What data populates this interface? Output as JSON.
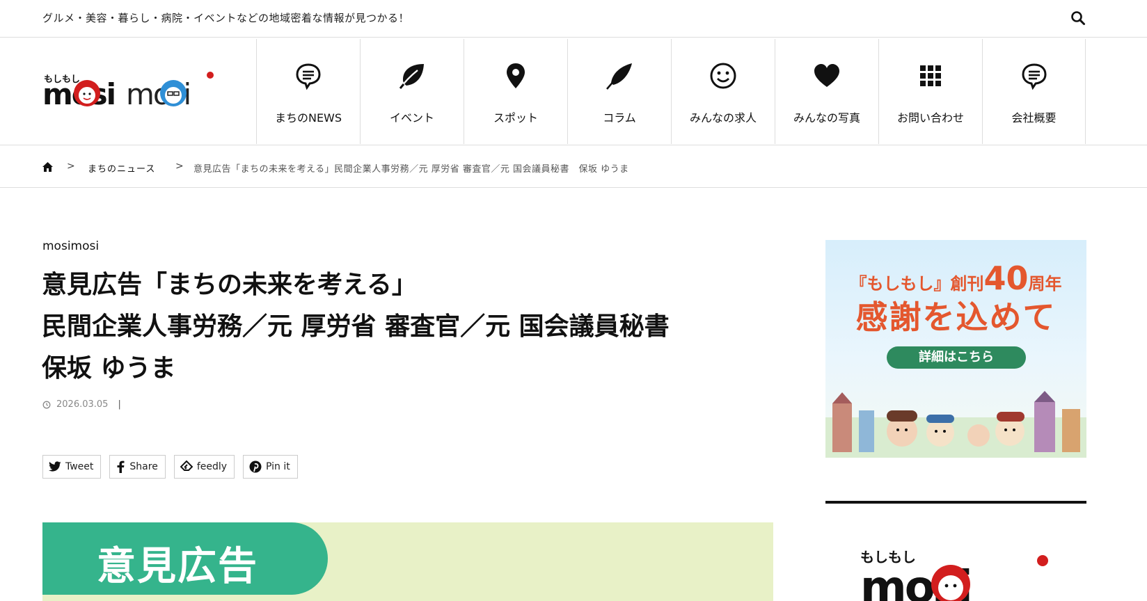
{
  "topbar": {
    "tagline": "グルメ・美容・暮らし・病院・イベントなどの地域密着な情報が見つかる！",
    "search_icon": "search-icon"
  },
  "logo": {
    "kana": "もしもし",
    "text_left": "mosi",
    "text_right": "mosi"
  },
  "nav": [
    {
      "label": "まちのNEWS",
      "icon": "speech-bubble-icon"
    },
    {
      "label": "イベント",
      "icon": "leaf-icon"
    },
    {
      "label": "スポット",
      "icon": "map-pin-icon"
    },
    {
      "label": "コラム",
      "icon": "quill-icon"
    },
    {
      "label": "みんなの求人",
      "icon": "smiley-icon"
    },
    {
      "label": "みんなの写真",
      "icon": "heart-icon"
    },
    {
      "label": "お問い合わせ",
      "icon": "grid-icon"
    },
    {
      "label": "会社概要",
      "icon": "speech-bubble-icon"
    }
  ],
  "breadcrumb": {
    "home_icon": "home-icon",
    "separator": ">",
    "category": "まちのニュース",
    "current": "意見広告「まちの未来を考える」民間企業人事労務／元 厚労省 審査官／元 国会議員秘書　保坂 ゆうま"
  },
  "article": {
    "category": "mosimosi",
    "title_lines": [
      "意見広告「まちの未来を考える」",
      "民間企業人事労務／元 厚労省 審査官／元 国会議員秘書",
      "保坂 ゆうま"
    ],
    "date": "2026.03.05",
    "meta_separator": "|"
  },
  "share": [
    {
      "label": "Tweet",
      "icon": "twitter-icon"
    },
    {
      "label": "Share",
      "icon": "facebook-icon"
    },
    {
      "label": "feedly",
      "icon": "feedly-icon"
    },
    {
      "label": "Pin it",
      "icon": "pinterest-icon"
    }
  ],
  "ad_banner": {
    "heading": "意見広告",
    "bg_color": "#e8f1c7",
    "pill_color": "#35b48c"
  },
  "sidebar": {
    "banner": {
      "line1_prefix": "『もしもし』創刊",
      "line1_number": "40",
      "line1_suffix": "周年",
      "line2": "感謝を込めて",
      "button": "詳細はこちら"
    },
    "logo": {
      "kana": "もしもし",
      "text": "mosi"
    }
  }
}
